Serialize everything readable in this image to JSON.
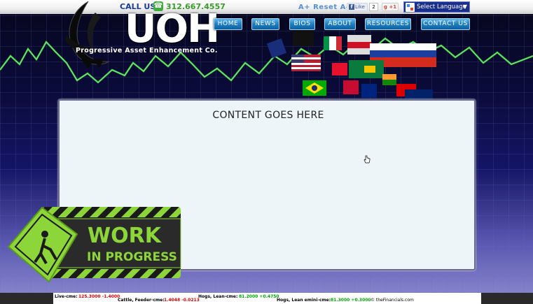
{
  "header": {
    "call_label": "CALL US!",
    "phone": "312.667.4557",
    "logo_text": "UOH",
    "logo_tagline": "Progressive Asset Enhancement Co.",
    "reset_label": "A+ Reset A-",
    "facebook_like": "Like",
    "facebook_count": "2",
    "gplus_label": "+1",
    "language_label": "Select Language",
    "language_arrow": "▼"
  },
  "nav": {
    "items": [
      "HOME",
      "NEWS",
      "BIOS",
      "ABOUT",
      "RESOURCES",
      "CONTACT US"
    ]
  },
  "main": {
    "title": "CONTENT GOES HERE"
  },
  "wip": {
    "line1": "WORK",
    "line2": "IN PROGRESS"
  },
  "ticker": {
    "items": [
      {
        "label": "Live-cme:",
        "value": "125.3000 -1.4000"
      },
      {
        "label": "Cattle, Feeder-cme:",
        "value": "1.4048 -0.0213"
      },
      {
        "label": "Hogs, Lean-cme:",
        "value": "81.2000 +0.4750"
      },
      {
        "label": "Hogs, Lean emini-cme:",
        "value": "81.3000 +0.3000"
      }
    ],
    "credit": "© theFinancials.com"
  },
  "colors": {
    "nav_button": "#1f7fc0",
    "content_bg": "#eef5f8",
    "wip_green": "#8cd63a",
    "ticker_down": "#dd0000",
    "ticker_up": "#00aa00"
  }
}
